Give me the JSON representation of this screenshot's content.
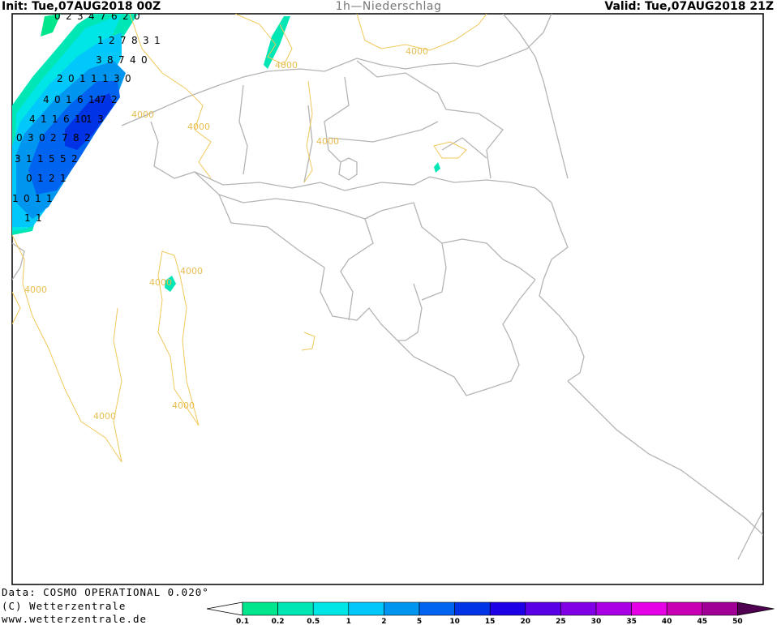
{
  "header": {
    "init": "Init: Tue,07AUG2018 00Z",
    "title": "1h—Niederschlag",
    "valid": "Valid: Tue,07AUG2018 21Z"
  },
  "footer": {
    "data_line": "Data: COSMO OPERATIONAL 0.020°",
    "copyright": "(C) Wetterzentrale",
    "url": "www.wetterzentrale.de"
  },
  "contour_label": "4000",
  "precip_labels": [
    [
      "0",
      "2",
      "3",
      "4",
      "7",
      "6",
      "2",
      "0"
    ],
    [
      "1",
      "2",
      "7",
      "8",
      "3",
      "1"
    ],
    [
      "3",
      "8",
      "7",
      "4",
      "0"
    ],
    [
      "2",
      "0",
      "1",
      "1",
      "1",
      "3",
      "0"
    ],
    [
      "4",
      "0",
      "1",
      "6",
      "14",
      "7",
      "2"
    ],
    [
      "4",
      "1",
      "1",
      "6",
      "10",
      "1",
      "3"
    ],
    [
      "0",
      "3",
      "0",
      "2",
      "7",
      "8",
      "2"
    ],
    [
      "3",
      "1",
      "1",
      "5",
      "5",
      "2"
    ],
    [
      "0",
      "1",
      "2",
      "1"
    ],
    [
      "1",
      "0",
      "1",
      "1"
    ],
    [
      "1",
      "1"
    ]
  ],
  "legend": {
    "ticks": [
      "0.1",
      "0.2",
      "0.5",
      "1",
      "2",
      "5",
      "10",
      "15",
      "20",
      "25",
      "30",
      "35",
      "40",
      "45",
      "50"
    ],
    "colors": [
      "#00e68c",
      "#00e6b4",
      "#00e6e6",
      "#00c8fa",
      "#0096f0",
      "#0064f0",
      "#0032e6",
      "#1e00e6",
      "#5a00e6",
      "#8200e6",
      "#aa00e6",
      "#e600e6",
      "#c800b4",
      "#a00096",
      "#780078",
      "#500050"
    ]
  }
}
